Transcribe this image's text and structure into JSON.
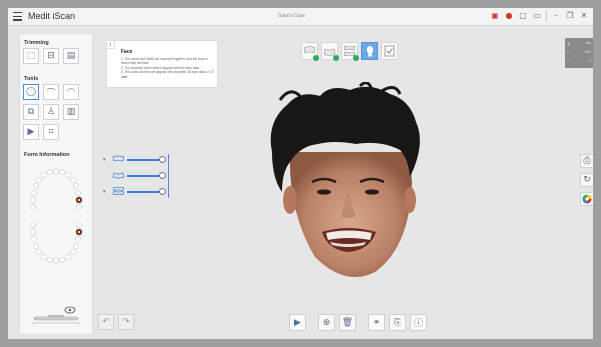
{
  "app": {
    "title": "Medit iScan",
    "case_name": "Sara's Case"
  },
  "titlebar_icons": [
    "flag-icon",
    "record-icon",
    "screenshot-icon",
    "monitor-icon",
    "minimize-icon",
    "maximize-icon",
    "close-icon"
  ],
  "left_panel": {
    "trimming_title": "Trimming",
    "tools_title": "Tools",
    "form_title": "Form Information",
    "trimming_tools": [
      "select-area-icon",
      "trim-icon",
      "lock-icon"
    ],
    "tools": [
      "lasso-icon",
      "smooth-icon",
      "fill-icon",
      "shape-icon",
      "sculpt-icon",
      "align-icon",
      "video-icon",
      "capture-icon"
    ]
  },
  "info_card": {
    "icon": "i",
    "title": "Face",
    "lines": [
      "1. The mouth and teeth are scanned together, and the scan is saved with the face.",
      "2. The scanned mesh data is aligned with the face data.",
      "3. This data can then be aligned with imported 3D face data or CT data."
    ]
  },
  "top_toolbar": {
    "steps": [
      "maxilla-step",
      "mandible-step",
      "occlusion-step",
      "face-step",
      "review-step"
    ],
    "active": "face-step"
  },
  "sliders": [
    {
      "name": "maxilla-opacity",
      "value": 1.0
    },
    {
      "name": "mandible-opacity",
      "value": 1.0
    },
    {
      "name": "face-opacity",
      "value": 1.0
    }
  ],
  "right_panel": {
    "rows": [
      {
        "label": "⦿",
        "value": "41s"
      },
      {
        "label": "⬚",
        "value": "0/41"
      },
      {
        "label": "~",
        "value": "0"
      }
    ]
  },
  "bottom_toolbar": [
    "play-icon",
    "zoom-icon",
    "delete-icon",
    "align-icon",
    "export-icon",
    "info-icon"
  ]
}
